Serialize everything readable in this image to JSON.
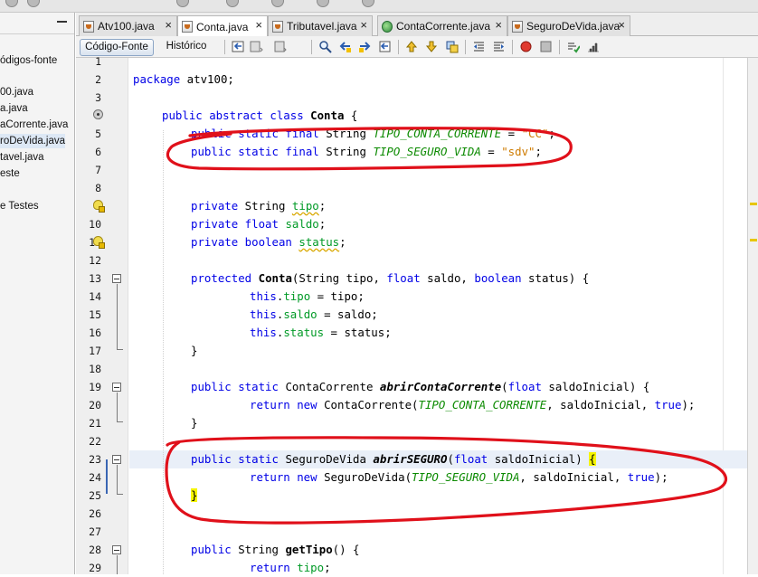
{
  "tabs": [
    {
      "label": "Atv100.java",
      "icon": "java-file-icon",
      "active": false
    },
    {
      "label": "Conta.java",
      "icon": "java-file-icon",
      "active": true
    },
    {
      "label": "Tributavel.java",
      "icon": "java-file-icon",
      "active": false
    },
    {
      "label": "ContaCorrente.java",
      "icon": "java-file-icon",
      "active": false
    },
    {
      "label": "SeguroDeVida.java",
      "icon": "java-file-icon",
      "active": false
    }
  ],
  "tab_close_glyph": "×",
  "project_tree": {
    "items": [
      "ódigos-fonte",
      "00.java",
      "a.java",
      "aCorrente.java",
      "roDeVida.java",
      "tavel.java",
      "este",
      "e Testes"
    ],
    "selected_index": 4
  },
  "editor_toolbar": {
    "source_label": "Código-Fonte",
    "history_label": "Histórico"
  },
  "code": {
    "line_numbers": [
      "1",
      "2",
      "3",
      "4",
      "5",
      "6",
      "7",
      "8",
      "9",
      "10",
      "11",
      "12",
      "13",
      "14",
      "15",
      "16",
      "17",
      "18",
      "19",
      "20",
      "21",
      "22",
      "23",
      "24",
      "25",
      "26",
      "27",
      "28",
      "29"
    ],
    "l2_a": "package",
    "l2_b": " atv100;",
    "l4_a": "public abstract class",
    "l4_b": " ",
    "l4_c": "Conta",
    "l4_d": " {",
    "l5_a": "public static final",
    "l5_b": " String ",
    "l5_c": "TIPO_CONTA_CORRENTE",
    "l5_d": " = ",
    "l5_e": "\"CC\"",
    "l5_f": ";",
    "l6_a": "public static final",
    "l6_b": " String ",
    "l6_c": "TIPO_SEGURO_VIDA",
    "l6_d": " = ",
    "l6_e": "\"sdv\"",
    "l6_f": ";",
    "l9_a": "private",
    "l9_b": " String ",
    "l9_c": "tipo",
    "l9_d": ";",
    "l10_a": "private float",
    "l10_b": " ",
    "l10_c": "saldo",
    "l10_d": ";",
    "l11_a": "private boolean",
    "l11_b": " ",
    "l11_c": "status",
    "l11_d": ";",
    "l13_a": "protected",
    "l13_b": " ",
    "l13_c": "Conta",
    "l13_d": "(String tipo, ",
    "l13_e": "float",
    "l13_f": " saldo, ",
    "l13_g": "boolean",
    "l13_h": " status) {",
    "l14_a": "this",
    "l14_b": ".",
    "l14_c": "tipo",
    "l14_d": " = tipo;",
    "l15_a": "this",
    "l15_b": ".",
    "l15_c": "saldo",
    "l15_d": " = saldo;",
    "l16_a": "this",
    "l16_b": ".",
    "l16_c": "status",
    "l16_d": " = status;",
    "l17": "}",
    "l19_a": "public static",
    "l19_b": " ContaCorrente ",
    "l19_c": "abrirContaCorrente",
    "l19_d": "(",
    "l19_e": "float",
    "l19_f": " saldoInicial) {",
    "l20_a": "return new",
    "l20_b": " ContaCorrente(",
    "l20_c": "TIPO_CONTA_CORRENTE",
    "l20_d": ", saldoInicial, ",
    "l20_e": "true",
    "l20_f": ");",
    "l21": "}",
    "l23_a": "public static",
    "l23_b": " SeguroDeVida ",
    "l23_c": "abrirSEGURO",
    "l23_d": "(",
    "l23_e": "float",
    "l23_f": " saldoInicial) ",
    "l23_g": "{",
    "l24_a": "return new",
    "l24_b": " SeguroDeVida(",
    "l24_c": "TIPO_SEGURO_VIDA",
    "l24_d": ", saldoInicial, ",
    "l24_e": "true",
    "l24_f": ");",
    "l25": "}",
    "l28_a": "public",
    "l28_b": " String ",
    "l28_c": "getTipo",
    "l28_d": "() {",
    "l29_a": "return",
    "l29_b": " ",
    "l29_c": "tipo",
    "l29_d": ";"
  },
  "colors": {
    "keyword": "#0000e6",
    "constant": "#0b8a00",
    "string": "#ce7b00",
    "field": "#009a26",
    "annotation_pen": "#e0101a",
    "brace_highlight": "#f5f500",
    "current_line": "#e9eff8"
  }
}
